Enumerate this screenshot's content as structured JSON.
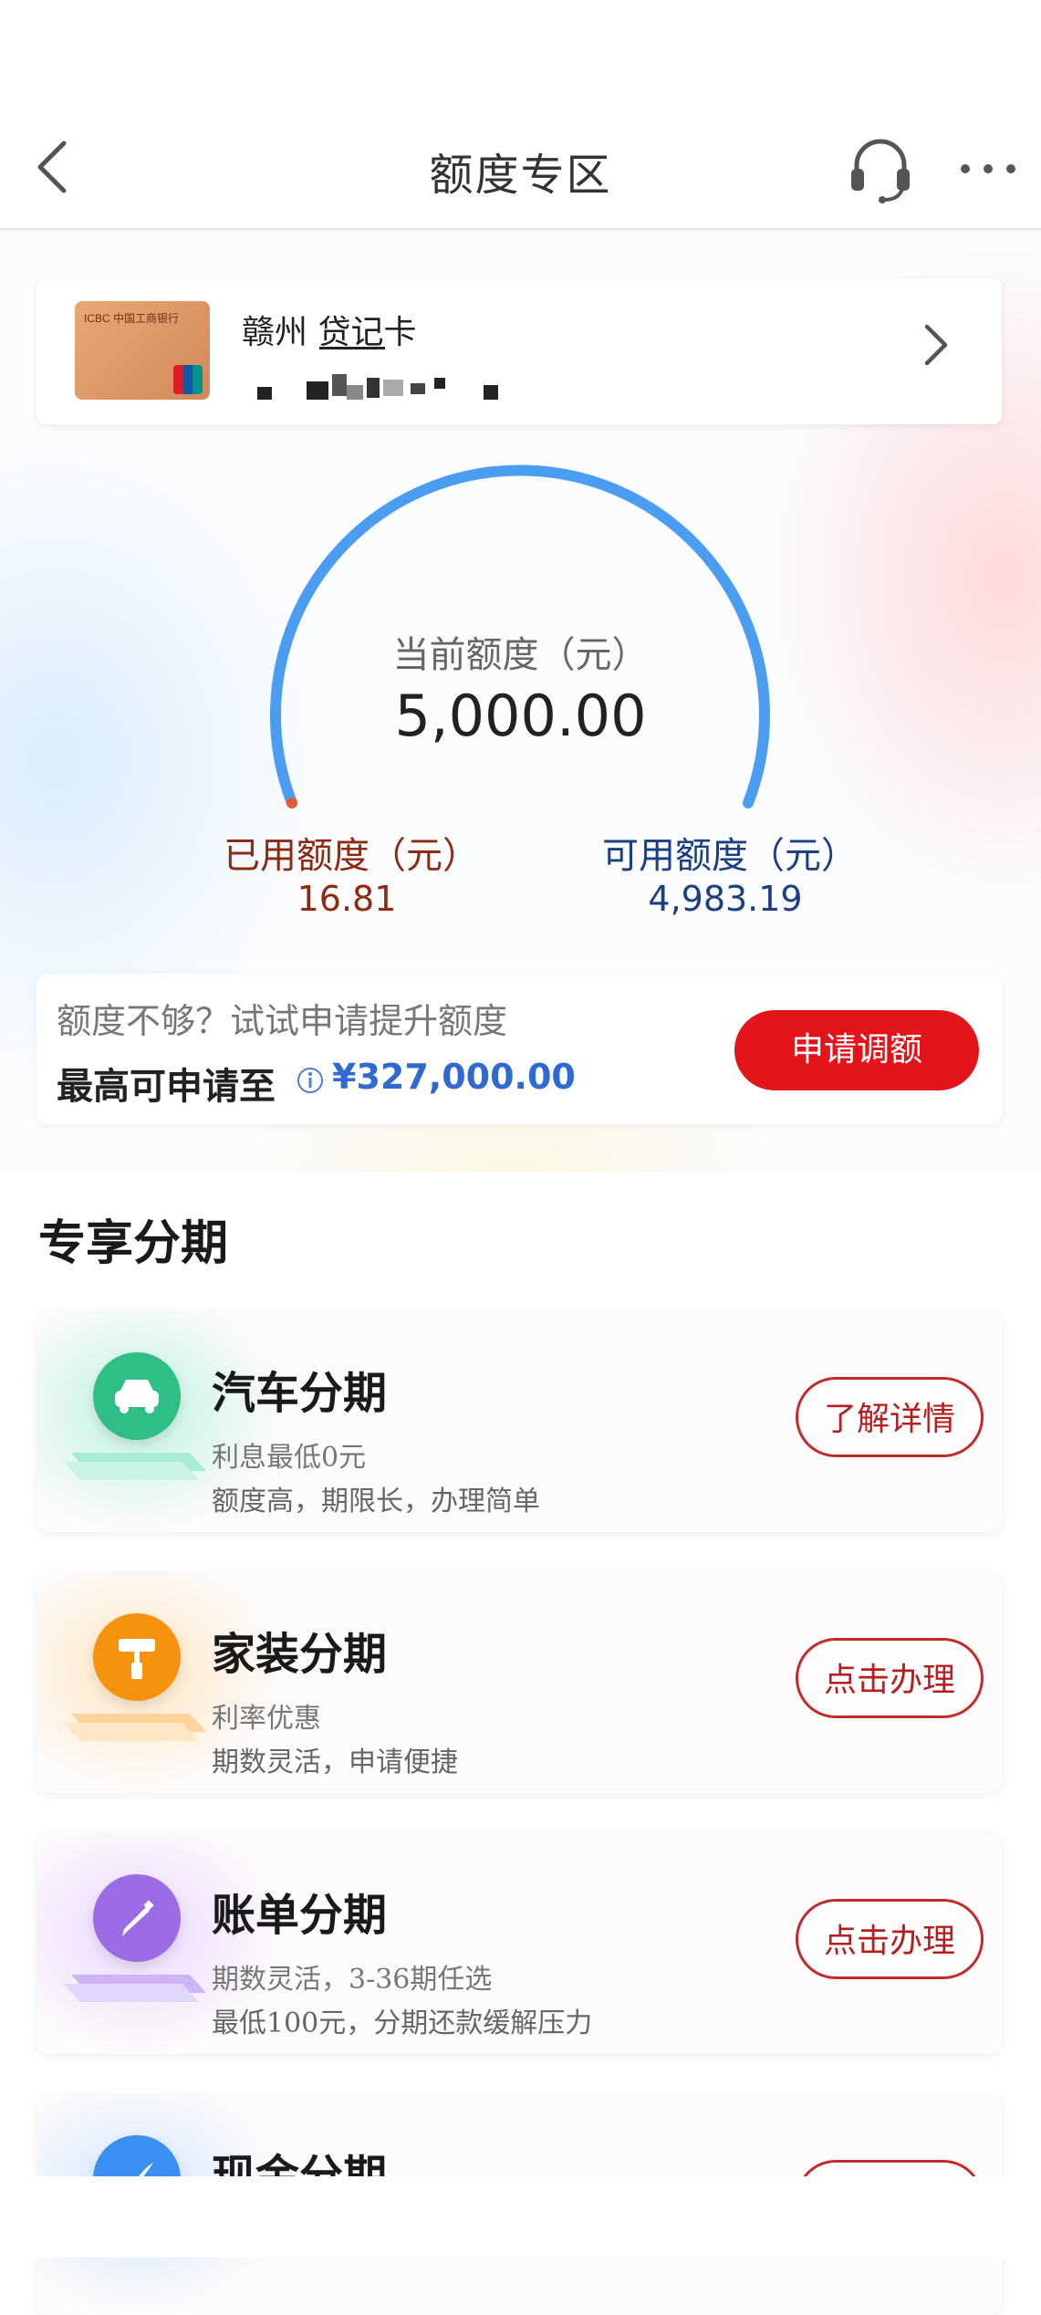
{
  "header": {
    "title": "额度专区",
    "back_icon": "chevron-left-icon",
    "support_icon": "headset-icon",
    "more_icon": "more-dots-icon"
  },
  "card": {
    "name": "赣州 贷记卡",
    "thumb_logo": "ICBC 中国工商银行"
  },
  "gauge": {
    "label": "当前额度（元）",
    "value": "5,000.00",
    "used_label": "已用额度（元）",
    "used_value": "16.81",
    "available_label": "可用额度（元）",
    "available_value": "4,983.19",
    "colors": {
      "arc": "#4a9df0",
      "used": "#8f2a12",
      "available": "#1c3f82"
    }
  },
  "limit": {
    "hint": "额度不够？试试申请提升额度",
    "max_label": "最高可申请至",
    "amount": "¥327,000.00",
    "apply_button": "申请调额"
  },
  "section": {
    "title": "专享分期"
  },
  "installments": [
    {
      "title": "汽车分期",
      "desc1": "利息最低0元",
      "desc2": "额度高，期限长，办理简单",
      "button": "了解详情",
      "icon": "car-icon",
      "color": "#2fbf86"
    },
    {
      "title": "家装分期",
      "desc1": "利率优惠",
      "desc2": "期数灵活，申请便捷",
      "button": "点击办理",
      "icon": "paint-roller-icon",
      "color": "#f5920e"
    },
    {
      "title": "账单分期",
      "desc1": "期数灵活，3-36期任选",
      "desc2": "最低100元，分期还款缓解压力",
      "button": "点击办理",
      "icon": "pencil-icon",
      "color": "#9b6ce6"
    },
    {
      "title": "现金分期",
      "icon": "rocket-icon",
      "color": "#3a8ff0"
    }
  ]
}
